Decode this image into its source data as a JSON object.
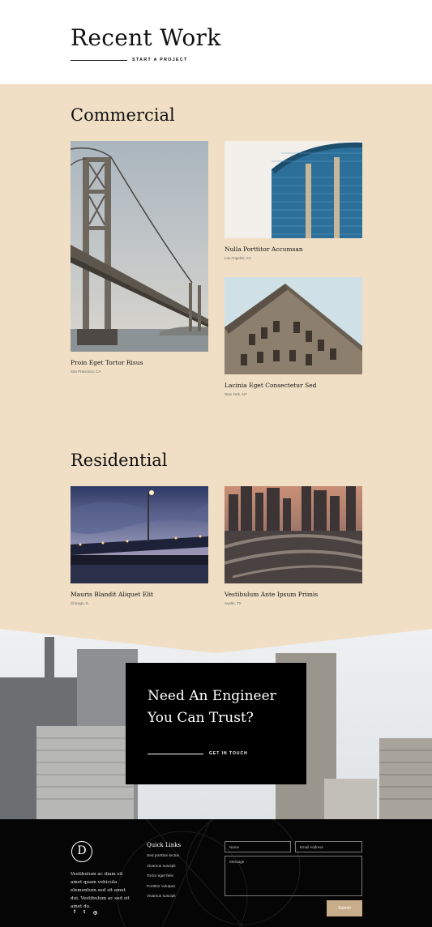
{
  "header": {
    "title": "Recent Work",
    "cta": "START A PROJECT"
  },
  "commercial": {
    "title": "Commercial",
    "items": [
      {
        "title": "Proin Eget Tortor Risus",
        "location": "San Francisco, CA"
      },
      {
        "title": "Nulla Porttitor Accumsan",
        "location": "Los Angeles, CA"
      },
      {
        "title": "Lacinia Eget Consectetur Sed",
        "location": "New York, NY"
      }
    ]
  },
  "residential": {
    "title": "Residential",
    "items": [
      {
        "title": "Mauris Blandit Aliquet Elit",
        "location": "Chicago, IL"
      },
      {
        "title": "Vestibulum Ante Ipsum Primis",
        "location": "Austin, TX"
      }
    ]
  },
  "cta_box": {
    "heading": "Need An Engineer You Can Trust?",
    "link": "GET IN TOUCH"
  },
  "footer": {
    "logo_letter": "D",
    "about": "Vestibulum ac diam sit amet quam vehicula elementum sed sit amet dui. Vestibulum ac sed sit amet du.",
    "social": [
      "f",
      "t",
      "◎"
    ],
    "quick_links_title": "Quick Links",
    "quick_links": [
      "Sed porttitor lectus",
      "Vivamus suscipit",
      "Tortor eget felis",
      "Porttitor volutpat",
      "Vivamus suscipit"
    ],
    "form": {
      "name_placeholder": "Name",
      "email_placeholder": "Email Address",
      "message_placeholder": "Message",
      "submit_label": "Submit"
    }
  },
  "colors": {
    "beige": "#f0dfc4",
    "black": "#000000",
    "accent": "#c8ad8a"
  }
}
